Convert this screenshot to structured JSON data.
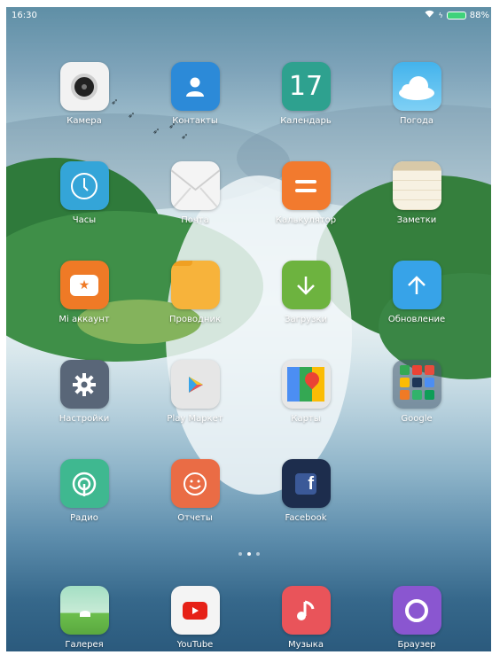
{
  "status_bar": {
    "time": "16:30",
    "battery": "88%"
  },
  "apps": [
    {
      "label": "Камера"
    },
    {
      "label": "Контакты"
    },
    {
      "label": "Календарь",
      "icon_text": "17"
    },
    {
      "label": "Погода"
    },
    {
      "label": "Часы"
    },
    {
      "label": "Почта"
    },
    {
      "label": "Калькулятор"
    },
    {
      "label": "Заметки"
    },
    {
      "label": "Mi аккаунт"
    },
    {
      "label": "Проводник"
    },
    {
      "label": "Загрузки"
    },
    {
      "label": "Обновление"
    },
    {
      "label": "Настройки"
    },
    {
      "label": "Play Маркет"
    },
    {
      "label": "Карты"
    },
    {
      "label": "Google"
    },
    {
      "label": "Радио"
    },
    {
      "label": "Отчеты"
    },
    {
      "label": "Facebook"
    }
  ],
  "page_indicator": {
    "pages": 3,
    "current": 2
  },
  "dock": [
    {
      "label": "Галерея"
    },
    {
      "label": "YouTube"
    },
    {
      "label": "Музыка"
    },
    {
      "label": "Браузер"
    }
  ],
  "colors": {
    "contacts": "#2c8ad8",
    "calendar": "#2ea18f",
    "calculator": "#f27a2e",
    "mi_account": "#ef7a26",
    "files": "#f7b33b",
    "downloads": "#6db33f",
    "update": "#37a3e8",
    "settings": "#596678",
    "radio": "#3fb890",
    "reports": "#ea6c45",
    "facebook": "#1d2d4d",
    "music": "#e9545a",
    "browser": "#8a56d0"
  }
}
